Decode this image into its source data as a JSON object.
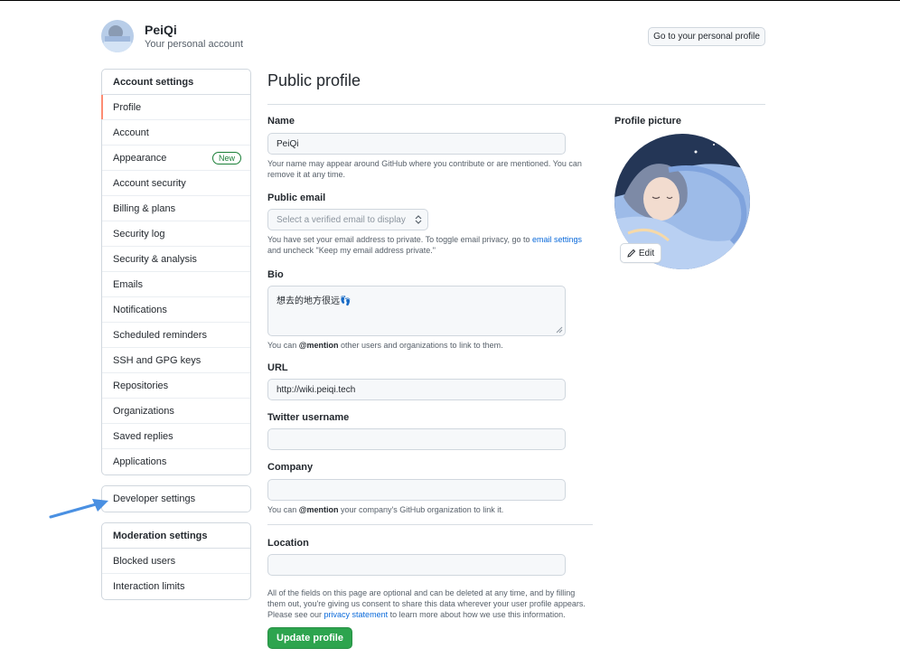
{
  "header": {
    "user_name": "PeiQi",
    "account_type": "Your personal account",
    "profile_button": "Go to your personal profile"
  },
  "sidebar": {
    "account_settings": {
      "heading": "Account settings",
      "items": [
        {
          "label": "Profile",
          "selected": true
        },
        {
          "label": "Account"
        },
        {
          "label": "Appearance",
          "badge": "New"
        },
        {
          "label": "Account security"
        },
        {
          "label": "Billing & plans"
        },
        {
          "label": "Security log"
        },
        {
          "label": "Security & analysis"
        },
        {
          "label": "Emails"
        },
        {
          "label": "Notifications"
        },
        {
          "label": "Scheduled reminders"
        },
        {
          "label": "SSH and GPG keys"
        },
        {
          "label": "Repositories"
        },
        {
          "label": "Organizations"
        },
        {
          "label": "Saved replies"
        },
        {
          "label": "Applications"
        }
      ]
    },
    "developer_settings": "Developer settings",
    "moderation": {
      "heading": "Moderation settings",
      "items": [
        {
          "label": "Blocked users"
        },
        {
          "label": "Interaction limits"
        }
      ]
    }
  },
  "main": {
    "title": "Public profile",
    "name": {
      "label": "Name",
      "value": "PeiQi",
      "note": "Your name may appear around GitHub where you contribute or are mentioned. You can remove it at any time."
    },
    "public_email": {
      "label": "Public email",
      "placeholder": "Select a verified email to display",
      "note_before": "You have set your email address to private. To toggle email privacy, go to ",
      "note_link": "email settings",
      "note_after": " and uncheck \"Keep my email address private.\""
    },
    "bio": {
      "label": "Bio",
      "value": "想去的地方很远👣",
      "note_before": "You can ",
      "note_bold": "@mention",
      "note_after": " other users and organizations to link to them."
    },
    "url": {
      "label": "URL",
      "value": "http://wiki.peiqi.tech"
    },
    "twitter": {
      "label": "Twitter username",
      "value": ""
    },
    "company": {
      "label": "Company",
      "value": "",
      "note_before": "You can ",
      "note_bold": "@mention",
      "note_after": " your company's GitHub organization to link it."
    },
    "location": {
      "label": "Location",
      "value": ""
    },
    "disclaimer_before": "All of the fields on this page are optional and can be deleted at any time, and by filling them out, you're giving us consent to share this data wherever your user profile appears. Please see our ",
    "disclaimer_link": "privacy statement",
    "disclaimer_after": " to learn more about how we use this information.",
    "update_button": "Update profile"
  },
  "profile_picture": {
    "label": "Profile picture",
    "edit_label": "Edit"
  },
  "colors": {
    "accent_selected": "#fd8c73",
    "primary_button": "#2da44e",
    "link": "#0969da",
    "annotation_arrow": "#4a90e2"
  }
}
